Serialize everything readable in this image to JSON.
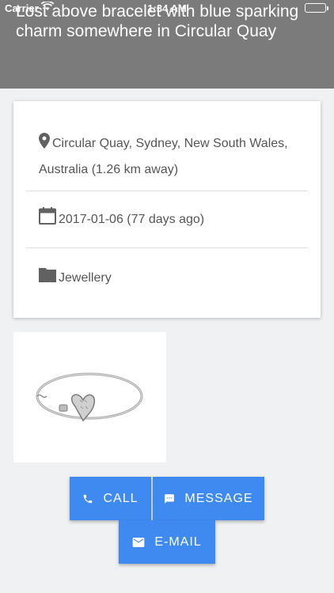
{
  "status_bar": {
    "carrier": "Carrier",
    "time": "1:34 AM"
  },
  "header": {
    "title": "Lost above bracelet with blue sparking charm somewhere in Circular Quay"
  },
  "details": {
    "location": "Circular Quay, Sydney, New South Wales, Australia (1.26 km away)",
    "date": "2017-01-06 (77 days ago)",
    "category": "Jewellery"
  },
  "icons": {
    "location": "map-pin-icon",
    "date": "calendar-icon",
    "category": "folder-icon",
    "call": "phone-icon",
    "message": "chat-icon",
    "email": "mail-icon"
  },
  "actions": {
    "call": "CALL",
    "message": "MESSAGE",
    "email": "E-MAIL"
  },
  "colors": {
    "header": "#7b7b7b",
    "button": "#3e8af0",
    "background": "#eff1f2"
  }
}
